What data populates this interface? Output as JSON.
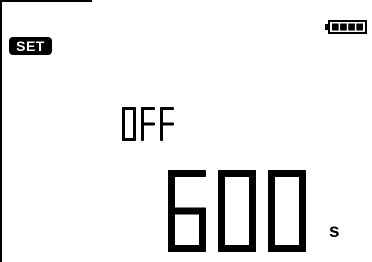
{
  "display": {
    "set_label": "SET",
    "mode_label": "OFF",
    "value": "600",
    "unit": "s"
  },
  "battery": {
    "icon": "battery-icon",
    "level": 1.0,
    "bars_filled": 4,
    "bars_total": 4
  },
  "colors": {
    "background": "#ffffff",
    "segment": "#000000"
  }
}
